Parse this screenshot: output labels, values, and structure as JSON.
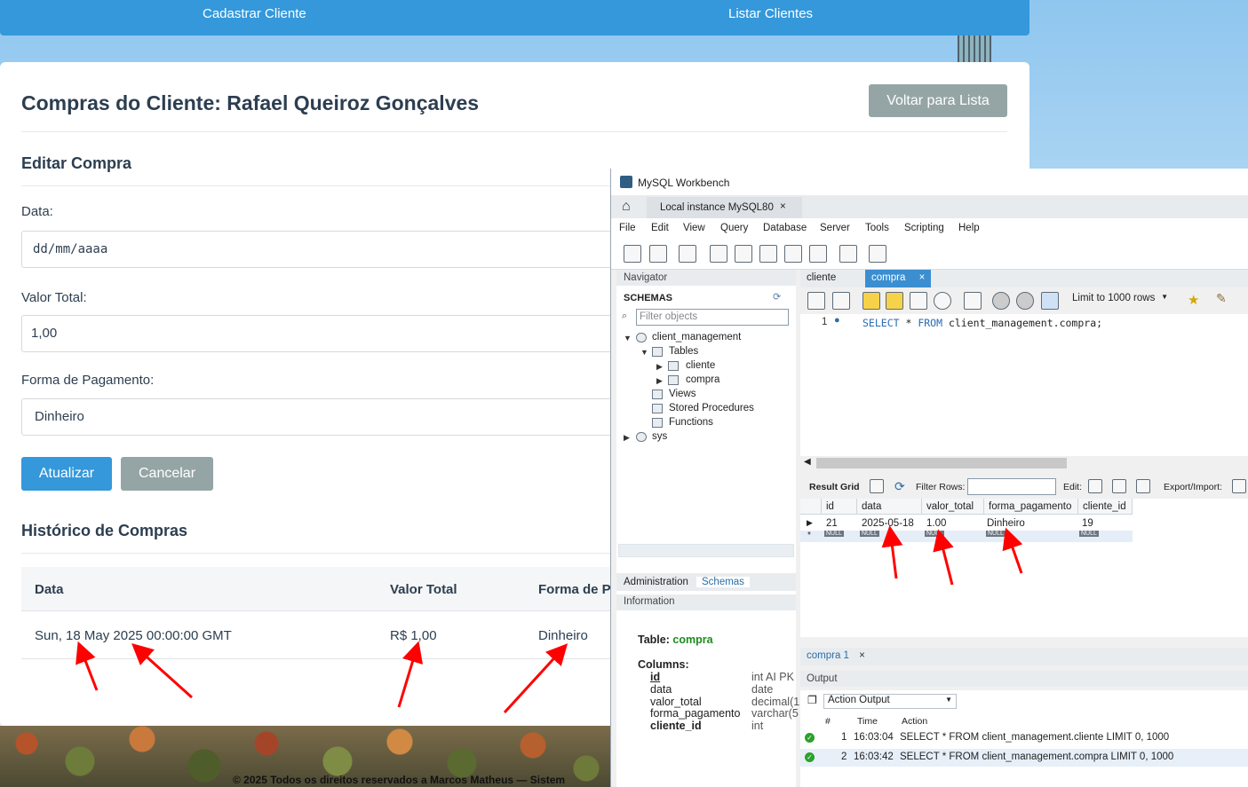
{
  "topnav": {
    "cadastrar": "Cadastrar Cliente",
    "listar": "Listar Clientes"
  },
  "page": {
    "title": "Compras do Cliente: Rafael Queiroz Gonçalves",
    "back_button": "Voltar para Lista",
    "edit_title": "Editar Compra",
    "data_label": "Data:",
    "data_value": "dd/mm/aaaa",
    "valor_label": "Valor Total:",
    "valor_value": "1,00",
    "forma_label": "Forma de Pagamento:",
    "forma_value": "Dinheiro",
    "update_button": "Atualizar",
    "cancel_button": "Cancelar",
    "history_title": "Histórico de Compras",
    "history_headers": [
      "Data",
      "Valor Total",
      "Forma de P"
    ],
    "history_row": [
      "Sun, 18 May 2025 00:00:00 GMT",
      "R$ 1,00",
      "Dinheiro"
    ],
    "footer": "© 2025 Todos os direitos reservados a Marcos Matheus — Sistem"
  },
  "workbench": {
    "title": "MySQL Workbench",
    "connection_tab": "Local instance MySQL80",
    "close_glyph": "×",
    "menu": [
      "File",
      "Edit",
      "View",
      "Query",
      "Database",
      "Server",
      "Tools",
      "Scripting",
      "Help"
    ],
    "navigator": {
      "header": "Navigator",
      "schemas": "SCHEMAS",
      "filter_placeholder": "Filter objects",
      "schema": "client_management",
      "tables": "Tables",
      "table1": "cliente",
      "table2": "compra",
      "views": "Views",
      "procedures": "Stored Procedures",
      "functions": "Functions",
      "sys": "sys",
      "tab_admin": "Administration",
      "tab_schemas": "Schemas",
      "info_header": "Information",
      "info_table_label": "Table:",
      "info_table_value": "compra",
      "columns_label": "Columns:",
      "columns": [
        {
          "name": "id",
          "type": "int AI PK"
        },
        {
          "name": "data",
          "type": "date"
        },
        {
          "name": "valor_total",
          "type": "decimal(1"
        },
        {
          "name": "forma_pagamento",
          "type": "varchar(5"
        },
        {
          "name": "cliente_id",
          "type": "int"
        }
      ]
    },
    "editor": {
      "tab_cliente": "cliente",
      "tab_compra": "compra",
      "limit": "Limit to 1000 rows",
      "line_no": "1",
      "sql_kw1": "SELECT",
      "sql_mid": " * ",
      "sql_kw2": "FROM",
      "sql_rest": " client_management.compra;"
    },
    "result": {
      "result_grid": "Result Grid",
      "filter_rows": "Filter Rows:",
      "edit": "Edit:",
      "export": "Export/Import:",
      "headers": [
        "id",
        "data",
        "valor_total",
        "forma_pagamento",
        "cliente_id"
      ],
      "row": [
        "21",
        "2025-05-18",
        "1.00",
        "Dinheiro",
        "19"
      ],
      "null": "NULL",
      "result_tab": "compra 1"
    },
    "output": {
      "header": "Output",
      "select": "Action Output",
      "headers": [
        "#",
        "Time",
        "Action"
      ],
      "rows": [
        {
          "n": "1",
          "time": "16:03:04",
          "action": "SELECT * FROM client_management.cliente LIMIT 0, 1000"
        },
        {
          "n": "2",
          "time": "16:03:42",
          "action": "SELECT * FROM client_management.compra LIMIT 0, 1000"
        }
      ]
    }
  },
  "colors": {
    "primary": "#3498db",
    "secondary": "#95a5a6",
    "heading": "#2c3e50",
    "annotation": "#ff0000"
  }
}
